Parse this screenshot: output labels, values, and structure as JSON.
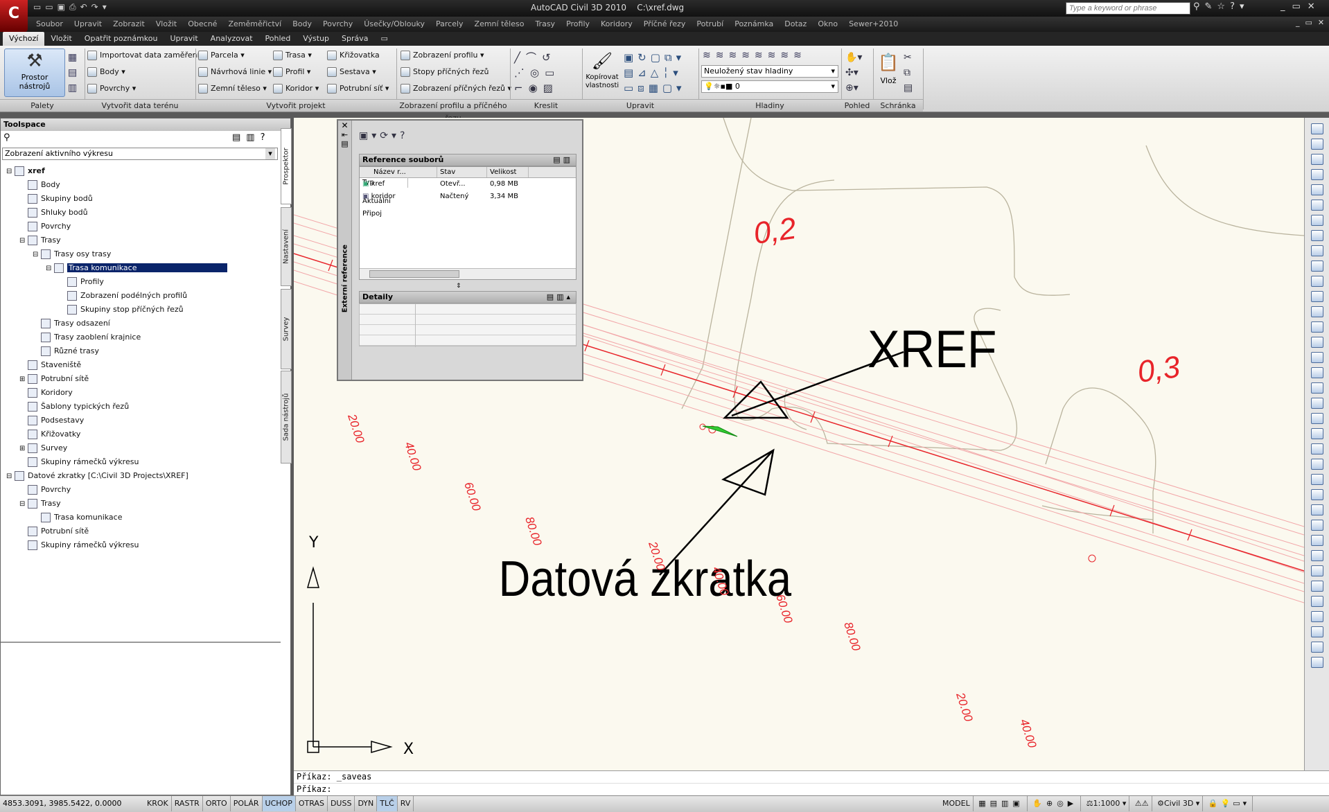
{
  "titlebar": {
    "title": "AutoCAD Civil 3D 2010",
    "file": "C:\\xref.dwg",
    "search_placeholder": "Type a keyword or phrase"
  },
  "menu": [
    "Soubor",
    "Upravit",
    "Zobrazit",
    "Vložit",
    "Obecné",
    "Zeměměřictví",
    "Body",
    "Povrchy",
    "Úsečky/Oblouky",
    "Parcely",
    "Zemní těleso",
    "Trasy",
    "Profily",
    "Koridory",
    "Příčné řezy",
    "Potrubí",
    "Poznámka",
    "Dotaz",
    "Okno",
    "Sewer+2010"
  ],
  "tabs": [
    "Výchozí",
    "Vložit",
    "Opatřit poznámkou",
    "Upravit",
    "Analyzovat",
    "Pohled",
    "Výstup",
    "Správa"
  ],
  "ribbon": {
    "big_button": "Prostor nástrojů",
    "terrain": [
      "Importovat data zaměření",
      "Body",
      "Povrchy"
    ],
    "project_col1": [
      "Parcela",
      "Návrhová linie",
      "Zemní těleso"
    ],
    "project_col2": [
      "Trasa",
      "Profil",
      "Koridor"
    ],
    "project_col3": [
      "Křižovatka",
      "Sestava",
      "Potrubní síť"
    ],
    "profile": [
      "Zobrazení profilu",
      "Stopy příčných řezů",
      "Zobrazení příčných řezů"
    ],
    "copy_props": "Kopírovat vlastnosti",
    "layer_state": "Neuložený stav hladiny",
    "layer_current": "0",
    "paste": "Vlož",
    "groups": [
      "Palety",
      "Vytvořit data terénu",
      "Vytvořit projekt",
      "Zobrazení profilu a příčného řezu",
      "Kreslit",
      "Upravit",
      "Hladiny",
      "Pohled",
      "Schránka"
    ]
  },
  "toolspace": {
    "title": "Toolspace",
    "view_select": "Zobrazení aktivního výkresu",
    "tree": [
      {
        "label": "xref",
        "level": 0,
        "bold": true
      },
      {
        "label": "Body",
        "level": 1
      },
      {
        "label": "Skupiny bodů",
        "level": 1
      },
      {
        "label": "Shluky bodů",
        "level": 1
      },
      {
        "label": "Povrchy",
        "level": 1
      },
      {
        "label": "Trasy",
        "level": 1
      },
      {
        "label": "Trasy osy trasy",
        "level": 2
      },
      {
        "label": "Trasa komunikace",
        "level": 3,
        "selected": true
      },
      {
        "label": "Profily",
        "level": 4
      },
      {
        "label": "Zobrazení podélných profilů",
        "level": 4
      },
      {
        "label": "Skupiny stop příčných řezů",
        "level": 4
      },
      {
        "label": "Trasy odsazení",
        "level": 2
      },
      {
        "label": "Trasy zaoblení krajnice",
        "level": 2
      },
      {
        "label": "Různé trasy",
        "level": 2
      },
      {
        "label": "Staveniště",
        "level": 1
      },
      {
        "label": "Potrubní sítě",
        "level": 1
      },
      {
        "label": "Koridory",
        "level": 1
      },
      {
        "label": "Šablony typických řezů",
        "level": 1
      },
      {
        "label": "Podsestavy",
        "level": 1
      },
      {
        "label": "Křižovatky",
        "level": 1
      },
      {
        "label": "Survey",
        "level": 1
      },
      {
        "label": "Skupiny rámečků výkresu",
        "level": 1
      },
      {
        "label": "Datové zkratky [C:\\Civil 3D Projects\\XREF]",
        "level": 0
      },
      {
        "label": "Povrchy",
        "level": 1
      },
      {
        "label": "Trasy",
        "level": 1
      },
      {
        "label": "Trasa komunikace",
        "level": 2
      },
      {
        "label": "Potrubní sítě",
        "level": 1
      },
      {
        "label": "Skupiny rámečků výkresu",
        "level": 1
      }
    ],
    "side_tabs": [
      "Prospektor",
      "Nastavení",
      "Survey",
      "Sada nástrojů"
    ]
  },
  "xref_palette": {
    "side_label": "Externí reference",
    "section_title": "Reference souborů",
    "columns": [
      "Název r...",
      "Stav",
      "Velikost",
      "Typ"
    ],
    "rows": [
      [
        "xref",
        "Otevř...",
        "0,98 MB",
        "Aktuální"
      ],
      [
        "koridor",
        "Načtený",
        "3,34 MB",
        "Připoj"
      ]
    ],
    "details_title": "Detaily"
  },
  "drawing": {
    "annotation_xref": "XREF",
    "annotation_shortcut": "Datová zkratka",
    "contour_labels": [
      "0,2",
      "0,3"
    ],
    "stations": [
      "20.00",
      "40.00",
      "60.00",
      "80.00",
      "20.00",
      "40.00",
      "60.00",
      "80.00",
      "20.00",
      "40.00"
    ],
    "ucs_x": "X",
    "ucs_y": "Y"
  },
  "command": {
    "line1": "Příkaz:  _saveas",
    "line2": "Příkaz:"
  },
  "status": {
    "coords": "4853.3091, 3985.5422, 0.0000",
    "toggles": [
      "KROK",
      "RASTR",
      "ORTO",
      "POLÁR",
      "UCHOP",
      "OTRAS",
      "DUSS",
      "DYN",
      "TLČ",
      "RV"
    ],
    "active_toggles": [
      "UCHOP",
      "TLČ"
    ],
    "model": "MODEL",
    "scale": "1:1000",
    "workspace": "Civil 3D"
  },
  "colors": {
    "canvas_bg": "#fbf9ef",
    "road_line": "#e8242a",
    "label_red": "#e8242a",
    "contour": "#b9b39d"
  }
}
